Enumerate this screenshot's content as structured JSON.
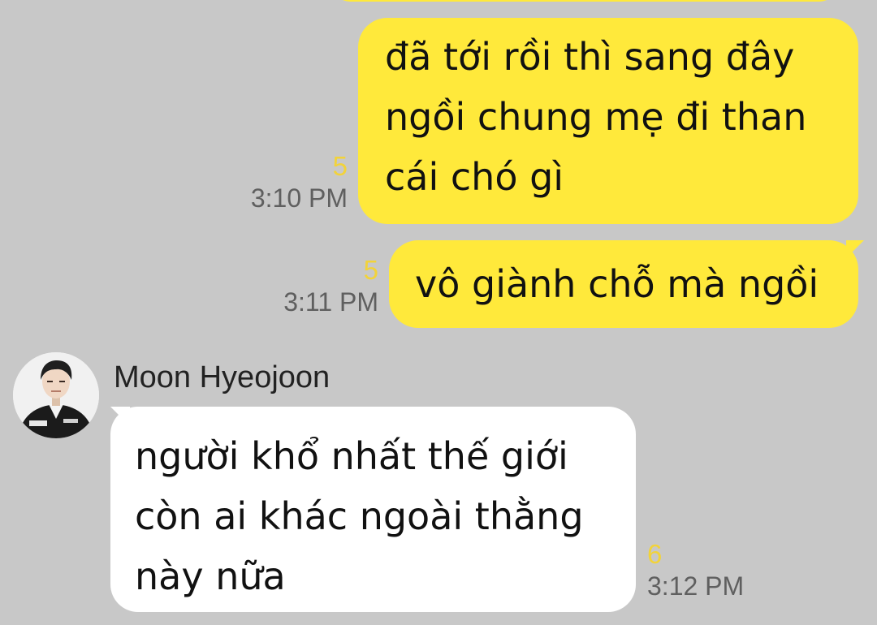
{
  "messages": [
    {
      "id": "m1",
      "side": "mine",
      "lines": [
        "đã tới rồi thì sang đây",
        "ngồi chung mẹ đi than",
        "cái chó gì"
      ],
      "unread": "5",
      "time": "3:10 PM"
    },
    {
      "id": "m2",
      "side": "mine",
      "lines": [
        "vô giành chỗ mà ngồi"
      ],
      "unread": "5",
      "time": "3:11 PM"
    },
    {
      "id": "m3",
      "side": "theirs",
      "sender": "Moon Hyeojoon",
      "lines": [
        "người khổ nhất thế giới",
        "còn ai khác ngoài thằng",
        "này nữa"
      ],
      "unread": "6",
      "time": "3:12 PM"
    }
  ],
  "colors": {
    "background": "#c8c8c8",
    "my_bubble": "#ffe93b",
    "their_bubble": "#ffffff",
    "unread_count": "#f2d33a",
    "timestamp": "#5f5f5f"
  },
  "icons": {
    "avatar": "profile-photo-avatar"
  }
}
